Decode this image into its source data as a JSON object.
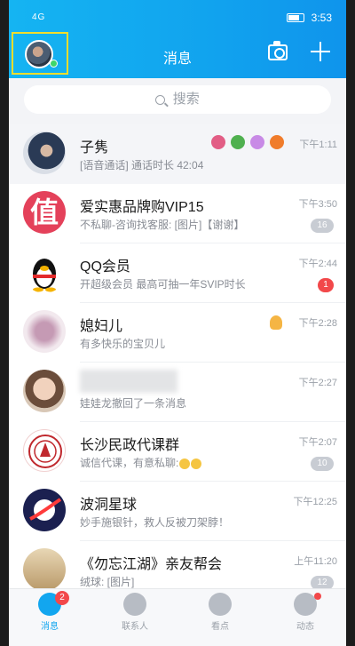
{
  "status_bar": {
    "left": "4G",
    "time": "3:53"
  },
  "header": {
    "title": "消息"
  },
  "search": {
    "placeholder": "搜索"
  },
  "conversations": [
    {
      "name": "子隽",
      "message": "[语音通话] 通话时长 42:04",
      "time": "下午1:11",
      "badge": ""
    },
    {
      "name": "爱实惠品牌购VIP15",
      "message": "不私聊-咨询找客服: [图片]【谢谢】",
      "time": "下午3:50",
      "badge": "16"
    },
    {
      "name": "QQ会员",
      "message": "开超级会员 最高可抽一年SVIP时长",
      "time": "下午2:44",
      "badge": "1"
    },
    {
      "name": "媳妇儿",
      "message": "有多快乐的宝贝儿",
      "time": "下午2:28",
      "badge": ""
    },
    {
      "name": "",
      "message": "娃娃龙撤回了一条消息",
      "time": "下午2:27",
      "badge": ""
    },
    {
      "name": "长沙民政代课群",
      "message": "诚信代课，有意私聊:",
      "time": "下午2:07",
      "badge": "10"
    },
    {
      "name": "波洞星球",
      "message": "妙手施银针，救人反被刀架脖！",
      "time": "下午12:25",
      "badge": ""
    },
    {
      "name": "《勿忘江湖》亲友帮会",
      "message": "绒球: [图片]",
      "time": "上午11:20",
      "badge": "12"
    }
  ],
  "avatar_text": {
    "zhi": "值"
  },
  "tabs": [
    {
      "label": "消息",
      "badge": "2"
    },
    {
      "label": "联系人",
      "badge": ""
    },
    {
      "label": "看点",
      "badge": ""
    },
    {
      "label": "动态",
      "badge": ""
    }
  ],
  "colors": {
    "header_blue": "#12a6ef",
    "badge_red": "#f2484a",
    "badge_gray": "#c8ccd3"
  }
}
